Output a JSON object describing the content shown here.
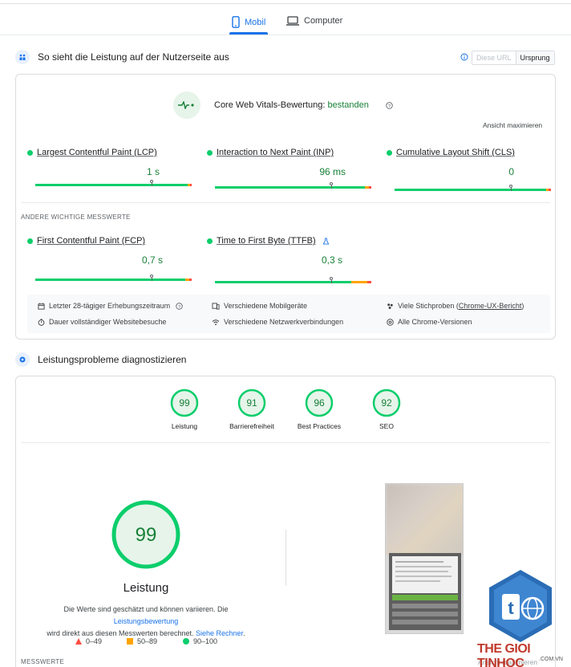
{
  "tabs": [
    {
      "label": "Mobil",
      "icon": "smartphone-icon",
      "active": true
    },
    {
      "label": "Computer",
      "icon": "laptop-icon",
      "active": false
    }
  ],
  "field_section": {
    "title": "So sieht die Leistung auf der Nutzerseite aus",
    "toggle": {
      "this_url": "Diese URL",
      "origin": "Ursprung"
    }
  },
  "cwv": {
    "assessment_label": "Core Web Vitals-Bewertung:",
    "assessment_result": "bestanden",
    "expand_label": "Ansicht maximieren",
    "metrics": [
      {
        "label": "Largest Contentful Paint (LCP)",
        "value": "1 s",
        "marker": 0.88
      },
      {
        "label": "Interaction to Next Paint (INP)",
        "value": "96 ms",
        "marker": 0.88
      },
      {
        "label": "Cumulative Layout Shift (CLS)",
        "value": "0",
        "marker": 0.75
      }
    ],
    "other_heading": "ANDERE WICHTIGE MESSWERTE",
    "other_metrics": [
      {
        "label": "First Contentful Paint (FCP)",
        "value": "0,7 s",
        "marker": 0.75
      },
      {
        "label": "Time to First Byte (TTFB)",
        "value": "0,3 s",
        "marker": 0.7
      }
    ],
    "info": {
      "period": "Letzter 28-tägiger Erhebungszeitraum",
      "duration": "Dauer vollständiger Websitebesuche",
      "devices": "Verschiedene Mobilgeräte",
      "network": "Verschiedene Netzwerkverbindungen",
      "samples_prefix": "Viele Stichproben (",
      "samples_link": "Chrome-UX-Bericht",
      "samples_suffix": ")",
      "versions": "Alle Chrome-Versionen"
    }
  },
  "diagnose_section": {
    "title": "Leistungsprobleme diagnostizieren",
    "scores": [
      {
        "label": "Leistung",
        "value": "99"
      },
      {
        "label": "Barrierefreiheit",
        "value": "91"
      },
      {
        "label": "Best Practices",
        "value": "96"
      },
      {
        "label": "SEO",
        "value": "92"
      }
    ],
    "big_score": {
      "value": "99",
      "label": "Leistung"
    },
    "note_part1": "Die Werte sind geschätzt und können variieren. Die ",
    "note_link1": "Leistungsbewertung",
    "note_part2": "wird direkt aus diesen Messwerten berechnet. ",
    "note_link2": "Siehe Rechner",
    "note_end": ".",
    "legend": [
      {
        "range": "0–49",
        "shape": "triangle",
        "color": "#ff4e42"
      },
      {
        "range": "50–89",
        "shape": "square",
        "color": "#ffa400"
      },
      {
        "range": "90–100",
        "shape": "circle",
        "color": "#0cce6b"
      }
    ],
    "measurements_heading": "MESSWERTE",
    "expand_label": "Ansicht maximieren"
  },
  "watermark": {
    "brand": "THE GIOI TINHOC",
    "domain": ".COM.VN"
  },
  "colors": {
    "accent": "#1a73e8",
    "pass": "#0cce6b",
    "pass_text": "#188038",
    "average": "#ffa400",
    "fail": "#ff4e42"
  }
}
